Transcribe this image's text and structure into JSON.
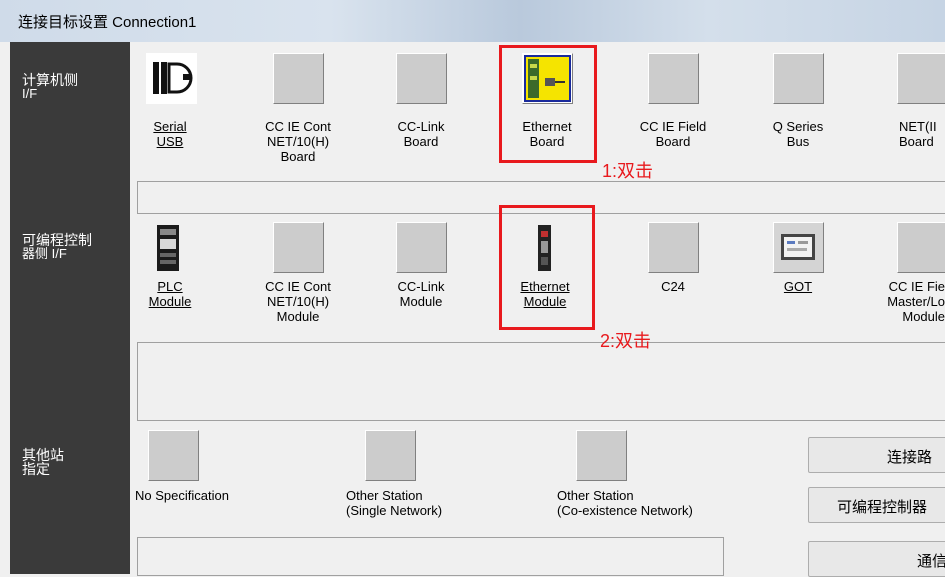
{
  "window": {
    "title": "连接目标设置 Connection1"
  },
  "sections": {
    "pc_side_label": [
      "计算机侧",
      "I/F"
    ],
    "plc_side_label": [
      "可编程控制",
      "器侧 I/F"
    ],
    "other_station_label": [
      "其他站",
      "指定"
    ]
  },
  "pc_side_items": [
    {
      "lines": [
        "Serial",
        "USB"
      ],
      "icon": "serial-usb-icon",
      "underlined": true
    },
    {
      "lines": [
        "CC IE Cont",
        "NET/10(H)",
        "Board"
      ],
      "icon": "blank-icon"
    },
    {
      "lines": [
        "CC-Link",
        "Board"
      ],
      "icon": "blank-icon"
    },
    {
      "lines": [
        "Ethernet",
        "Board"
      ],
      "icon": "ethernet-board-icon"
    },
    {
      "lines": [
        "CC IE Field",
        "Board"
      ],
      "icon": "blank-icon"
    },
    {
      "lines": [
        "Q Series",
        "Bus"
      ],
      "icon": "blank-icon"
    },
    {
      "lines": [
        "NET(II",
        "Board"
      ],
      "icon": "blank-icon"
    }
  ],
  "plc_side_items": [
    {
      "lines": [
        "PLC",
        "Module"
      ],
      "icon": "plc-module-icon",
      "underlined": true
    },
    {
      "lines": [
        "CC IE Cont",
        "NET/10(H)",
        "Module"
      ],
      "icon": "blank-icon"
    },
    {
      "lines": [
        "CC-Link",
        "Module"
      ],
      "icon": "blank-icon"
    },
    {
      "lines": [
        "Ethernet",
        "Module"
      ],
      "icon": "ethernet-module-icon",
      "underlined": true
    },
    {
      "lines": [
        "C24"
      ],
      "icon": "blank-icon"
    },
    {
      "lines": [
        "GOT"
      ],
      "icon": "got-icon",
      "underlined": true
    },
    {
      "lines": [
        "CC IE Fie",
        "Master/Lo",
        "Module"
      ],
      "icon": "blank-icon"
    }
  ],
  "other_station_items": [
    {
      "lines": [
        "No Specification"
      ],
      "icon": "blank-icon"
    },
    {
      "lines": [
        "Other Station",
        "(Single Network)"
      ],
      "icon": "blank-icon"
    },
    {
      "lines": [
        "Other Station",
        "(Co-existence Network)"
      ],
      "icon": "blank-icon"
    }
  ],
  "annotations": {
    "note1": "1:双击",
    "note2": "2:双击"
  },
  "right_buttons": {
    "route": "连接路",
    "plc": "可编程控制器",
    "comm": "通信"
  },
  "colors": {
    "annotation_red": "#e8191d",
    "side_panel": "#3a3a3a"
  }
}
